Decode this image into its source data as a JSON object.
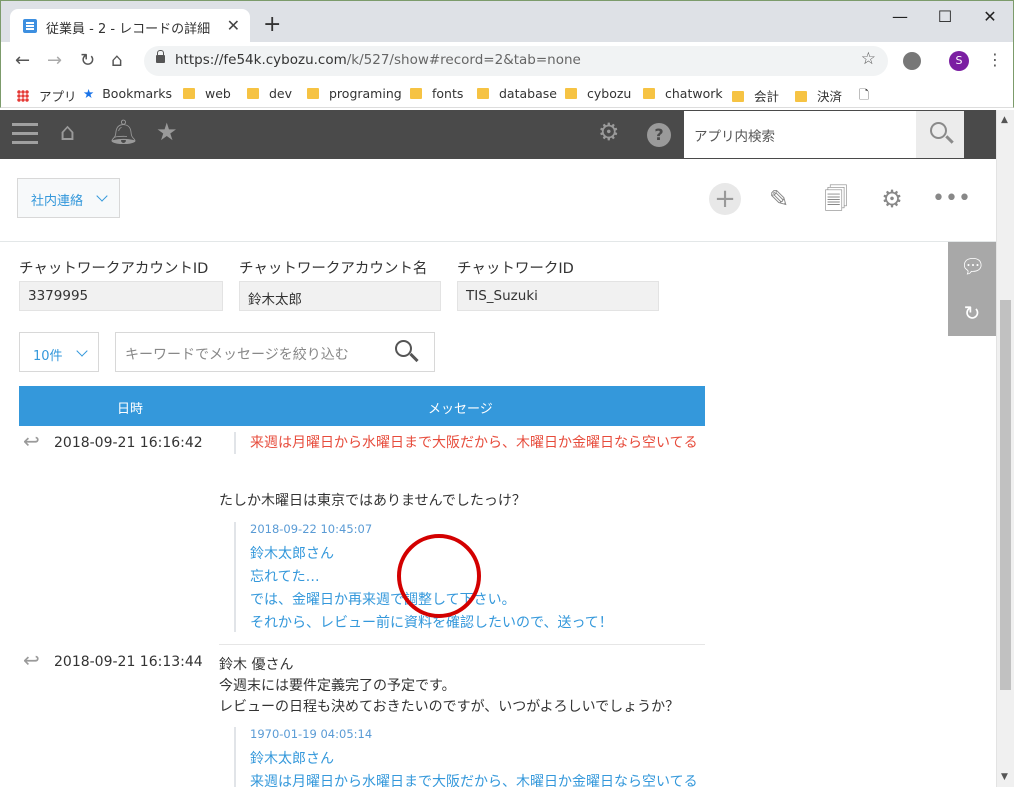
{
  "browser": {
    "tab_title": "従業員 - 2 - レコードの詳細",
    "url_host": "https://fe54k.cybozu.com",
    "url_path": "/k/527/show#record=2&tab=none",
    "profile_initial": "S",
    "bookmarks": [
      "アプリ",
      "Bookmarks",
      "web",
      "dev",
      "programing",
      "fonts",
      "database",
      "cybozu",
      "chatwork",
      "会計",
      "決済"
    ]
  },
  "app": {
    "search_placeholder": "アプリ内検索",
    "view_selector": "社内連絡"
  },
  "fields": [
    {
      "label": "チャットワークアカウントID",
      "value": "3379995"
    },
    {
      "label": "チャットワークアカウント名",
      "value": "鈴木太郎"
    },
    {
      "label": "チャットワークID",
      "value": "TIS_Suzuki"
    }
  ],
  "filter": {
    "count": "10件",
    "keyword_placeholder": "キーワードでメッセージを絞り込む"
  },
  "table": {
    "headers": [
      "日時",
      "メッセージ"
    ],
    "rows": [
      {
        "datetime": "2018-09-21 16:16:42",
        "quoted_top": "来週は月曜日から水曜日まで大阪だから、木曜日か金曜日なら空いてる",
        "body": "たしか木曜日は東京ではありませんでしたっけ？",
        "quote": {
          "date": "2018-09-22 10:45:07",
          "lines": [
            "鈴木太郎さん",
            "忘れてた…",
            "では、金曜日か再来週で調整して下さい。",
            "それから、レビュー前に資料を確認したいので、送って！"
          ]
        }
      },
      {
        "datetime": "2018-09-21 16:13:44",
        "lines": [
          "鈴木 優さん",
          "今週末には要件定義完了の予定です。",
          "レビューの日程も決めておきたいのですが、いつがよろしいでしょうか？"
        ],
        "quote": {
          "date": "1970-01-19 04:05:14",
          "lines": [
            "鈴木太郎さん",
            "来週は月曜日から水曜日まで大阪だから、木曜日か金曜日なら空いてる"
          ]
        }
      }
    ]
  }
}
